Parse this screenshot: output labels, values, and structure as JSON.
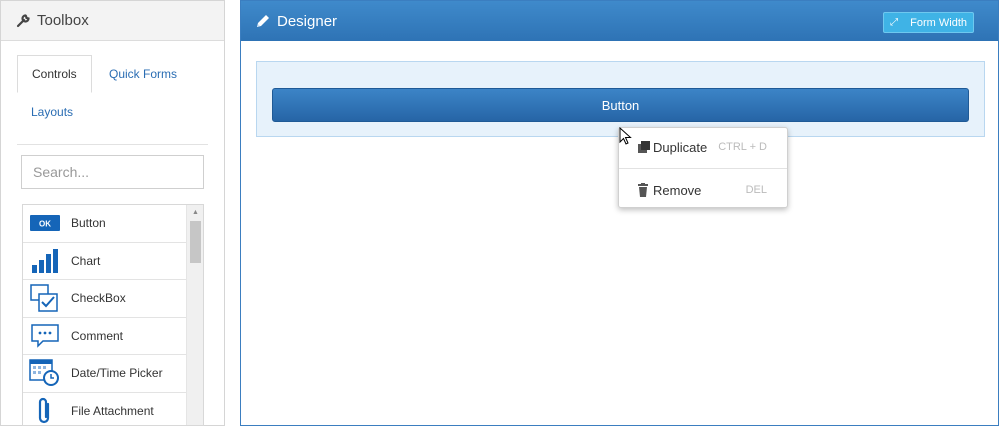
{
  "toolbox": {
    "title": "Toolbox",
    "icon": "wrench-icon",
    "tabs": [
      {
        "label": "Controls",
        "active": true
      },
      {
        "label": "Quick Forms",
        "active": false
      },
      {
        "label": "Layouts",
        "active": false
      }
    ],
    "search": {
      "placeholder": "Search...",
      "value": ""
    },
    "controls": [
      {
        "label": "Button",
        "icon": "ok-button-icon"
      },
      {
        "label": "Chart",
        "icon": "bar-chart-icon"
      },
      {
        "label": "CheckBox",
        "icon": "checkbox-icon"
      },
      {
        "label": "Comment",
        "icon": "comment-icon"
      },
      {
        "label": "Date/Time Picker",
        "icon": "calendar-clock-icon"
      },
      {
        "label": "File Attachment",
        "icon": "paperclip-icon"
      }
    ],
    "button_icon_text": "OK"
  },
  "designer": {
    "title": "Designer",
    "icon": "pencil-icon",
    "form_width_label": "Form Width",
    "form_button_label": "Button"
  },
  "context_menu": {
    "items": [
      {
        "label": "Duplicate",
        "shortcut": "CTRL + D",
        "icon": "duplicate-icon"
      },
      {
        "label": "Remove",
        "shortcut": "DEL",
        "icon": "trash-icon"
      }
    ]
  },
  "colors": {
    "designer_header": "#2e73b5",
    "accent_button": "#3fb3e6",
    "link": "#2a6db3"
  }
}
